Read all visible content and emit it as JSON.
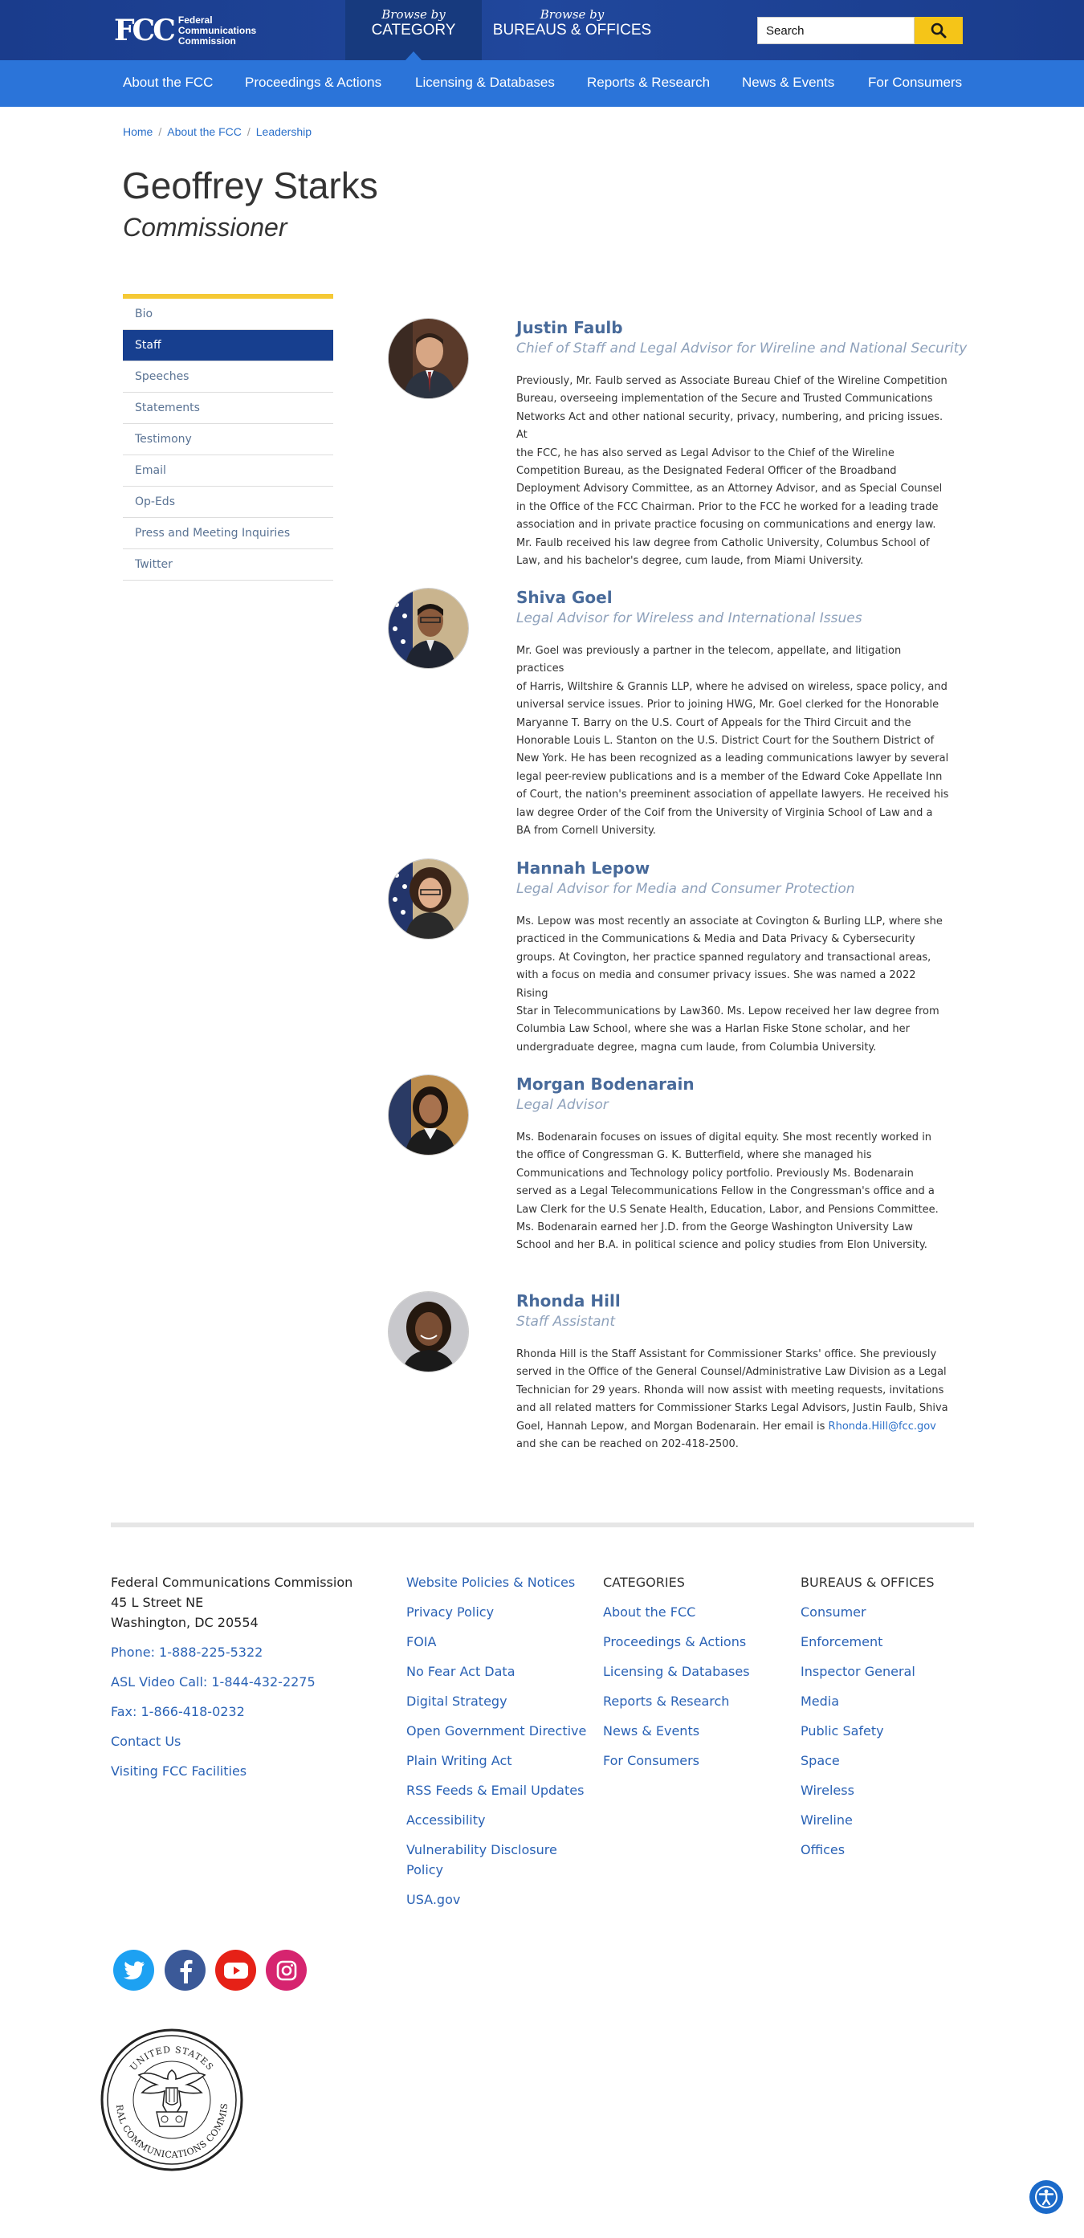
{
  "header": {
    "logo_mark": "FCC",
    "logo_lines": [
      "Federal",
      "Communications",
      "Commission"
    ],
    "browse_category_small": "Browse by",
    "browse_category_big": "CATEGORY",
    "browse_bureaus_small": "Browse by",
    "browse_bureaus_big": "BUREAUS & OFFICES",
    "search_placeholder": "Search",
    "colors": {
      "header_bg": "#1a3c8c",
      "nav_bg": "#2b74d9",
      "search_button": "#f5c518"
    }
  },
  "nav": [
    "About the FCC",
    "Proceedings & Actions",
    "Licensing & Databases",
    "Reports & Research",
    "News & Events",
    "For Consumers"
  ],
  "breadcrumb": [
    "Home",
    "About the FCC",
    "Leadership"
  ],
  "title": "Geoffrey Starks",
  "subtitle": "Commissioner",
  "sidemenu": {
    "active_index": 1,
    "items": [
      "Bio",
      "Staff",
      "Speeches",
      "Statements",
      "Testimony",
      "Email",
      "Op-Eds",
      "Press and Meeting Inquiries",
      "Twitter"
    ]
  },
  "staff": [
    {
      "name": "Justin Faulb",
      "role": "Chief of Staff and Legal Advisor for Wireline and National Security",
      "bio_lines": [
        "Previously, Mr. Faulb served as Associate Bureau Chief of the Wireline Competition",
        "Bureau, overseeing implementation of the Secure and Trusted Communications",
        "Networks Act and other national security, privacy, numbering, and pricing issues. At",
        "the FCC, he has also served as Legal Advisor to the Chief of the Wireline",
        "Competition Bureau, as the Designated Federal Officer of the Broadband",
        "Deployment Advisory Committee, as an Attorney Advisor, and as Special Counsel",
        "in the Office of the FCC Chairman. Prior to the FCC he worked for a leading trade",
        "association and in private practice focusing on communications and energy law.",
        "Mr. Faulb received his law degree from Catholic University, Columbus School of",
        "Law, and his bachelor's degree, cum laude, from Miami University."
      ]
    },
    {
      "name": "Shiva Goel",
      "role": "Legal Advisor for Wireless and International Issues",
      "bio_lines": [
        "Mr. Goel was previously a partner in the telecom, appellate, and litigation practices",
        "of Harris, Wiltshire & Grannis LLP, where he advised on wireless, space policy, and",
        "universal service issues. Prior to joining HWG, Mr. Goel clerked for the Honorable",
        "Maryanne T. Barry on the U.S. Court of Appeals for the Third Circuit and the",
        "Honorable Louis L. Stanton on the U.S. District Court for the Southern District of",
        "New York. He has been recognized as a leading communications lawyer by several",
        "legal peer-review publications and is a member of the Edward Coke Appellate Inn",
        "of Court, the nation's preeminent association of appellate lawyers. He received his",
        "law degree Order of the Coif from the University of Virginia School of Law and a",
        "BA from Cornell University."
      ]
    },
    {
      "name": "Hannah Lepow",
      "role": "Legal Advisor for Media and Consumer Protection",
      "bio_lines": [
        "Ms. Lepow was most recently an associate at Covington & Burling LLP, where she",
        "practiced in the Communications & Media and Data Privacy & Cybersecurity",
        "groups. At Covington, her practice spanned regulatory and transactional areas,",
        "with a focus on media and consumer privacy issues. She was named a 2022 Rising",
        "Star in Telecommunications by Law360. Ms. Lepow received her law degree from",
        "Columbia Law School, where she was a Harlan Fiske Stone scholar, and her",
        "undergraduate degree, magna cum laude, from Columbia University."
      ]
    },
    {
      "name": "Morgan Bodenarain",
      "role": "Legal Advisor",
      "bio_lines": [
        "Ms. Bodenarain focuses on issues of digital equity. She most recently worked in",
        "the office of Congressman G. K. Butterfield, where she managed his",
        "Communications and Technology policy portfolio. Previously Ms. Bodenarain",
        "served as a Legal Telecommunications Fellow in the Congressman's office and a",
        "Law Clerk for the U.S Senate Health, Education, Labor, and Pensions Committee.",
        "Ms. Bodenarain earned her J.D. from the George Washington University Law",
        "School and her B.A. in political science and policy studies from Elon University."
      ]
    },
    {
      "name": "Rhonda Hill",
      "role": "Staff Assistant",
      "bio_lines": [
        "Rhonda Hill is the Staff Assistant for Commissioner Starks' office. She previously",
        "served in the Office of the General Counsel/Administrative Law Division as a Legal",
        "Technician for 29 years. Rhonda will now assist with meeting requests, invitations",
        "and all related matters for Commissioner Starks Legal Advisors, Justin Faulb, Shiva",
        "Goel, Hannah Lepow, and Morgan Bodenarain. Her email is ",
        "and she can be reached on 202-418-2500."
      ],
      "email": "Rhonda.Hill@fcc.gov"
    }
  ],
  "footer": {
    "address": [
      "Federal Communications Commission",
      "45 L Street NE",
      "Washington, DC 20554"
    ],
    "contact_links": [
      "Phone: 1-888-225-5322",
      "ASL Video Call: 1-844-432-2275",
      "Fax: 1-866-418-0232",
      "Contact Us",
      "Visiting FCC Facilities"
    ],
    "policy_links": [
      "Website Policies & Notices",
      "Privacy Policy",
      "FOIA",
      "No Fear Act Data",
      "Digital Strategy",
      "Open Government Directive",
      "Plain Writing Act",
      "RSS Feeds & Email Updates",
      "Accessibility",
      "Vulnerability Disclosure",
      "Policy",
      "USA.gov"
    ],
    "categories_header": "CATEGORIES",
    "categories": [
      "About the FCC",
      "Proceedings & Actions",
      "Licensing & Databases",
      "Reports & Research",
      "News & Events",
      "For Consumers"
    ],
    "bureaus_header": "BUREAUS & OFFICES",
    "bureaus": [
      "Consumer",
      "Enforcement",
      "Inspector General",
      "Media",
      "Public Safety",
      "Space",
      "Wireless",
      "Wireline",
      "Offices"
    ],
    "social_icons": [
      "twitter-icon",
      "facebook-icon",
      "youtube-icon",
      "instagram-icon"
    ],
    "social_colors": [
      "#1da1f2",
      "#3b5998",
      "#e62117",
      "#d6246f"
    ],
    "seal_outer_text": "UNITED STATES",
    "seal_inner_text": "FEDERAL COMMUNICATIONS COMMISSION"
  }
}
